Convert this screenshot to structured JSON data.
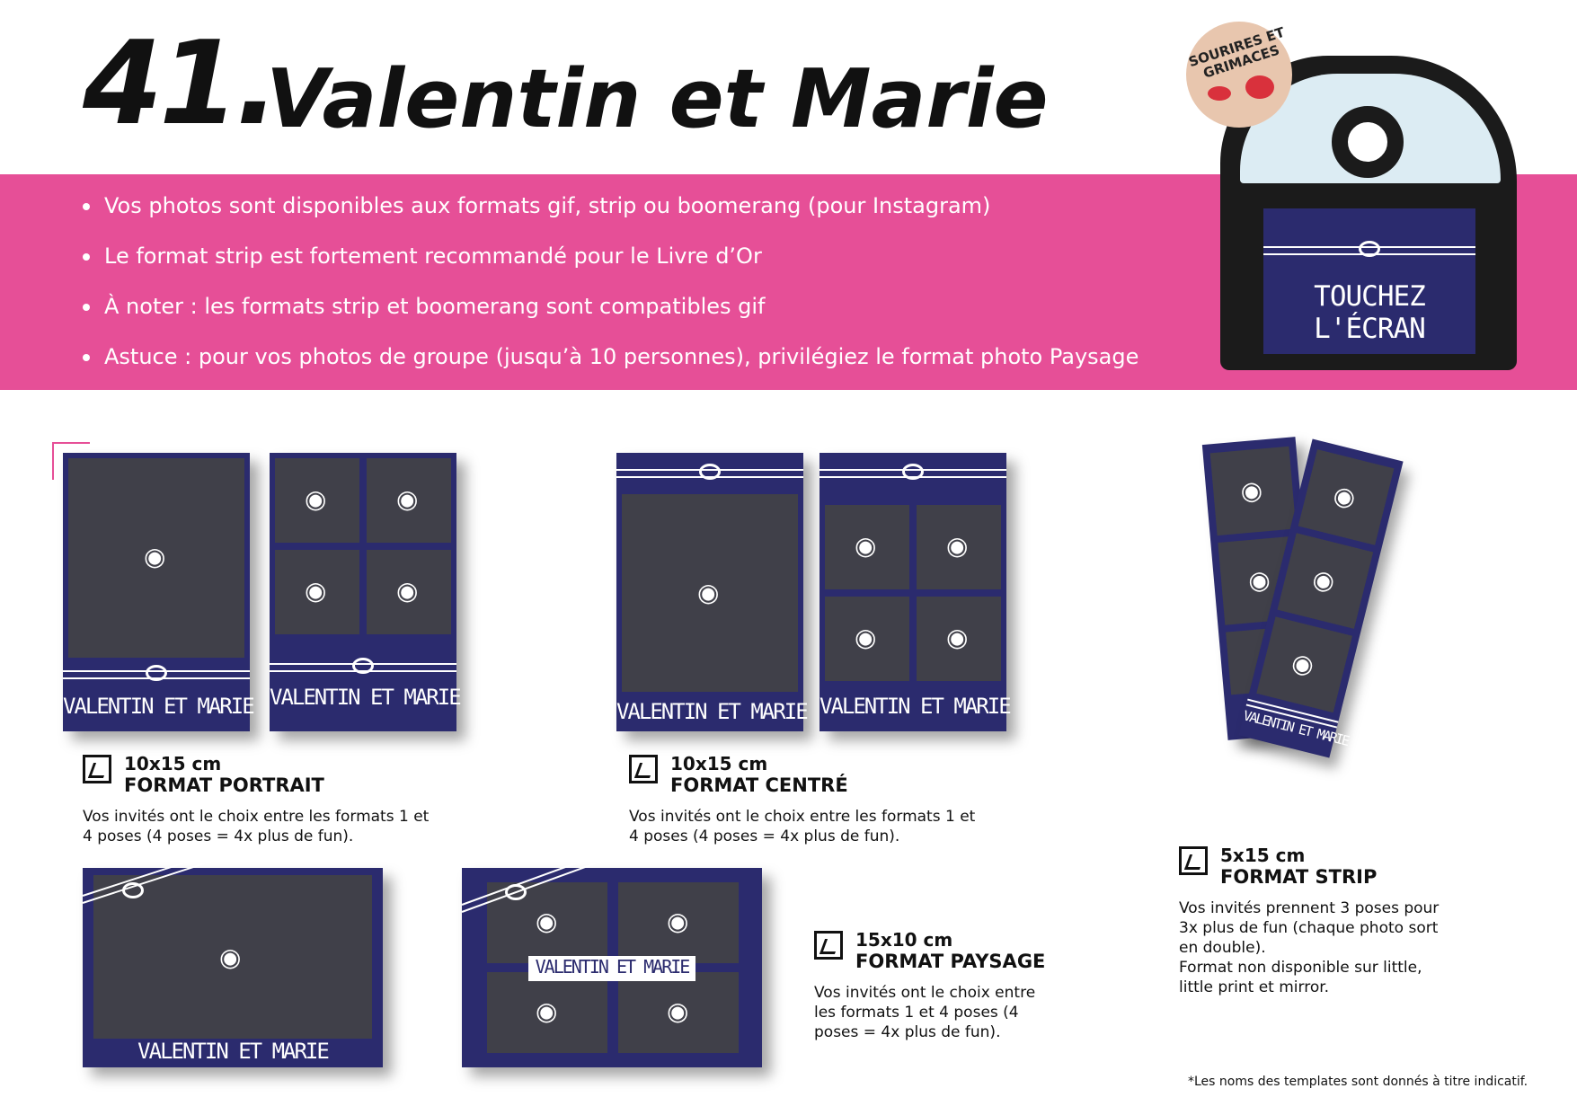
{
  "header": {
    "number": "41.",
    "title": "Valentin et Marie"
  },
  "bullets": [
    "Vos photos sont disponibles aux formats gif, strip ou boomerang (pour Instagram)",
    "Le format strip est fortement recommandé pour le Livre d’Or",
    "À noter : les formats strip et boomerang sont compatibles gif",
    "Astuce : pour vos photos de groupe (jusqu’à 10 personnes), privilégiez le format photo Paysage"
  ],
  "device": {
    "screen_text": "TOUCHEZ L'ÉCRAN",
    "badge_text": "SOURIRES ET GRIMACES"
  },
  "template_label": "VALENTIN ET MARIE",
  "formats": {
    "portrait": {
      "size": "10x15 cm",
      "name": "FORMAT PORTRAIT",
      "desc": "Vos invités ont le choix entre les formats 1 et\n4 poses (4 poses = 4x plus de fun)."
    },
    "centre": {
      "size": "10x15 cm",
      "name": "FORMAT CENTRÉ",
      "desc": "Vos invités ont le choix entre les formats 1 et\n4 poses (4 poses = 4x plus de fun)."
    },
    "strip": {
      "size": "5x15 cm",
      "name": "FORMAT STRIP",
      "desc": "Vos invités prennent 3 poses pour\n3x plus de fun (chaque photo sort\nen double).\nFormat non disponible sur little,\nlittle print et mirror."
    },
    "paysage": {
      "size": "15x10 cm",
      "name": "FORMAT PAYSAGE",
      "desc": "Vos invités ont le choix entre\nles formats 1 et 4 poses (4\nposes = 4x plus de fun)."
    }
  },
  "footnote": "*Les noms des templates sont donnés à titre indicatif.",
  "icons": {
    "camera": "◉"
  },
  "colors": {
    "pink": "#e64f97",
    "navy": "#2b2b6e",
    "slot": "#404049"
  }
}
